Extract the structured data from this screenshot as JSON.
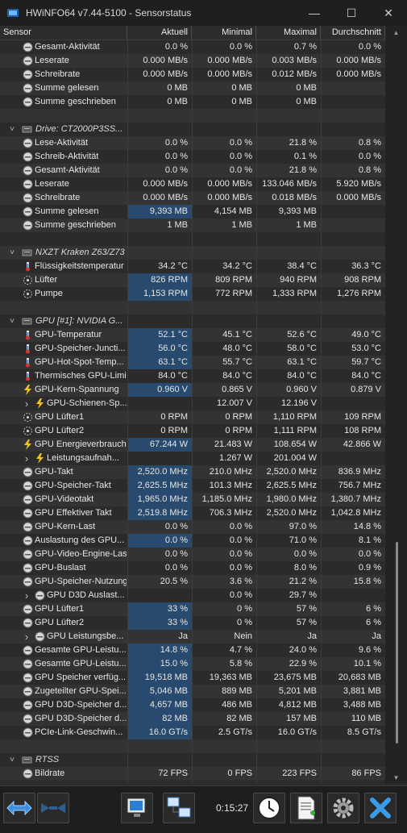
{
  "window": {
    "title": "HWiNFO64 v7.44-5100 - Sensorstatus"
  },
  "columns": [
    "Sensor",
    "Aktuell",
    "Minimal",
    "Maximal",
    "Durchschnitt"
  ],
  "rows": [
    {
      "type": "item",
      "icon": "circle",
      "label": "Gesamt-Aktivität",
      "v": [
        "0.0 %",
        "0.0 %",
        "0.7 %",
        "0.0 %"
      ]
    },
    {
      "type": "item",
      "icon": "circle",
      "label": "Leserate",
      "v": [
        "0.000 MB/s",
        "0.000 MB/s",
        "0.003 MB/s",
        "0.000 MB/s"
      ]
    },
    {
      "type": "item",
      "icon": "circle",
      "label": "Schreibrate",
      "v": [
        "0.000 MB/s",
        "0.000 MB/s",
        "0.012 MB/s",
        "0.000 MB/s"
      ]
    },
    {
      "type": "item",
      "icon": "circle",
      "label": "Summe gelesen",
      "v": [
        "0 MB",
        "0 MB",
        "0 MB",
        ""
      ]
    },
    {
      "type": "item",
      "icon": "circle",
      "label": "Summe geschrieben",
      "v": [
        "0 MB",
        "0 MB",
        "0 MB",
        ""
      ]
    },
    {
      "type": "blank"
    },
    {
      "type": "group",
      "label": "Drive: CT2000P3SS..."
    },
    {
      "type": "item",
      "icon": "circle",
      "label": "Lese-Aktivität",
      "v": [
        "0.0 %",
        "0.0 %",
        "21.8 %",
        "0.8 %"
      ]
    },
    {
      "type": "item",
      "icon": "circle",
      "label": "Schreib-Aktivität",
      "v": [
        "0.0 %",
        "0.0 %",
        "0.1 %",
        "0.0 %"
      ]
    },
    {
      "type": "item",
      "icon": "circle",
      "label": "Gesamt-Aktivität",
      "v": [
        "0.0 %",
        "0.0 %",
        "21.8 %",
        "0.8 %"
      ]
    },
    {
      "type": "item",
      "icon": "circle",
      "label": "Leserate",
      "v": [
        "0.000 MB/s",
        "0.000 MB/s",
        "133.046 MB/s",
        "5.920 MB/s"
      ]
    },
    {
      "type": "item",
      "icon": "circle",
      "label": "Schreibrate",
      "v": [
        "0.000 MB/s",
        "0.000 MB/s",
        "0.018 MB/s",
        "0.000 MB/s"
      ]
    },
    {
      "type": "item",
      "icon": "circle",
      "label": "Summe gelesen",
      "v": [
        "9,393 MB",
        "4,154 MB",
        "9,393 MB",
        ""
      ],
      "hl": true
    },
    {
      "type": "item",
      "icon": "circle",
      "label": "Summe geschrieben",
      "v": [
        "1 MB",
        "1 MB",
        "1 MB",
        ""
      ]
    },
    {
      "type": "blank"
    },
    {
      "type": "group",
      "label": "NXZT Kraken Z63/Z73"
    },
    {
      "type": "item",
      "icon": "thermo",
      "label": "Flüssigkeitstemperatur",
      "v": [
        "34.2 °C",
        "34.2 °C",
        "38.4 °C",
        "36.3 °C"
      ]
    },
    {
      "type": "item",
      "icon": "fan",
      "label": "Lüfter",
      "v": [
        "826 RPM",
        "809 RPM",
        "940 RPM",
        "908 RPM"
      ],
      "hl": true
    },
    {
      "type": "item",
      "icon": "fan",
      "label": "Pumpe",
      "v": [
        "1,153 RPM",
        "772 RPM",
        "1,333 RPM",
        "1,276 RPM"
      ],
      "hl": true
    },
    {
      "type": "blank"
    },
    {
      "type": "group",
      "label": "GPU [#1]: NVIDIA G..."
    },
    {
      "type": "item",
      "icon": "thermo",
      "label": "GPU-Temperatur",
      "v": [
        "52.1 °C",
        "45.1 °C",
        "52.6 °C",
        "49.0 °C"
      ],
      "hl": true
    },
    {
      "type": "item",
      "icon": "thermo",
      "label": "GPU-Speicher-Juncti...",
      "v": [
        "56.0 °C",
        "48.0 °C",
        "58.0 °C",
        "53.0 °C"
      ],
      "hl": true
    },
    {
      "type": "item",
      "icon": "thermo",
      "label": "GPU-Hot-Spot-Temp...",
      "v": [
        "63.1 °C",
        "55.7 °C",
        "63.1 °C",
        "59.7 °C"
      ],
      "hl": true
    },
    {
      "type": "item",
      "icon": "thermo",
      "label": "Thermisches GPU-Limit",
      "v": [
        "84.0 °C",
        "84.0 °C",
        "84.0 °C",
        "84.0 °C"
      ]
    },
    {
      "type": "item",
      "icon": "bolt",
      "label": "GPU-Kern-Spannung",
      "v": [
        "0.960 V",
        "0.865 V",
        "0.960 V",
        "0.879 V"
      ],
      "hl": true
    },
    {
      "type": "sub",
      "icon": "bolt",
      "label": "GPU-Schienen-Sp...",
      "v": [
        "",
        "12.007 V",
        "12.196 V",
        ""
      ]
    },
    {
      "type": "item",
      "icon": "fan",
      "label": "GPU Lüfter1",
      "v": [
        "0 RPM",
        "0 RPM",
        "1,110 RPM",
        "109 RPM"
      ]
    },
    {
      "type": "item",
      "icon": "fan",
      "label": "GPU Lüfter2",
      "v": [
        "0 RPM",
        "0 RPM",
        "1,111 RPM",
        "108 RPM"
      ]
    },
    {
      "type": "item",
      "icon": "bolt",
      "label": "GPU Energieverbrauch",
      "v": [
        "67.244 W",
        "21.483 W",
        "108.654 W",
        "42.866 W"
      ],
      "hl": true
    },
    {
      "type": "sub",
      "icon": "bolt",
      "label": "Leistungsaufnah...",
      "v": [
        "",
        "1.267 W",
        "201.004 W",
        ""
      ]
    },
    {
      "type": "item",
      "icon": "circle",
      "label": "GPU-Takt",
      "v": [
        "2,520.0 MHz",
        "210.0 MHz",
        "2,520.0 MHz",
        "836.9 MHz"
      ],
      "hl": true
    },
    {
      "type": "item",
      "icon": "circle",
      "label": "GPU-Speicher-Takt",
      "v": [
        "2,625.5 MHz",
        "101.3 MHz",
        "2,625.5 MHz",
        "756.7 MHz"
      ],
      "hl": true
    },
    {
      "type": "item",
      "icon": "circle",
      "label": "GPU-Videotakt",
      "v": [
        "1,965.0 MHz",
        "1,185.0 MHz",
        "1,980.0 MHz",
        "1,380.7 MHz"
      ],
      "hl": true
    },
    {
      "type": "item",
      "icon": "circle",
      "label": "GPU Effektiver Takt",
      "v": [
        "2,519.8 MHz",
        "706.3 MHz",
        "2,520.0 MHz",
        "1,042.8 MHz"
      ],
      "hl": true
    },
    {
      "type": "item",
      "icon": "circle",
      "label": "GPU-Kern-Last",
      "v": [
        "0.0 %",
        "0.0 %",
        "97.0 %",
        "14.8 %"
      ]
    },
    {
      "type": "item",
      "icon": "circle",
      "label": "Auslastung des GPU...",
      "v": [
        "0.0 %",
        "0.0 %",
        "71.0 %",
        "8.1 %"
      ],
      "hl": true
    },
    {
      "type": "item",
      "icon": "circle",
      "label": "GPU-Video-Engine-Last",
      "v": [
        "0.0 %",
        "0.0 %",
        "0.0 %",
        "0.0 %"
      ]
    },
    {
      "type": "item",
      "icon": "circle",
      "label": "GPU-Buslast",
      "v": [
        "0.0 %",
        "0.0 %",
        "8.0 %",
        "0.9 %"
      ]
    },
    {
      "type": "item",
      "icon": "circle",
      "label": "GPU-Speicher-Nutzung",
      "v": [
        "20.5 %",
        "3.6 %",
        "21.2 %",
        "15.8 %"
      ]
    },
    {
      "type": "sub",
      "icon": "circle",
      "label": "GPU D3D Auslast...",
      "v": [
        "",
        "0.0 %",
        "29.7 %",
        ""
      ]
    },
    {
      "type": "item",
      "icon": "circle",
      "label": "GPU Lüfter1",
      "v": [
        "33 %",
        "0 %",
        "57 %",
        "6 %"
      ],
      "hl": true
    },
    {
      "type": "item",
      "icon": "circle",
      "label": "GPU Lüfter2",
      "v": [
        "33 %",
        "0 %",
        "57 %",
        "6 %"
      ],
      "hl": true
    },
    {
      "type": "sub",
      "icon": "circle",
      "label": "GPU Leistungsbe...",
      "v": [
        "Ja",
        "Nein",
        "Ja",
        "Ja"
      ]
    },
    {
      "type": "item",
      "icon": "circle",
      "label": "Gesamte GPU-Leistu...",
      "v": [
        "14.8 %",
        "4.7 %",
        "24.0 %",
        "9.6 %"
      ],
      "hl": true
    },
    {
      "type": "item",
      "icon": "circle",
      "label": "Gesamte GPU-Leistu...",
      "v": [
        "15.0 %",
        "5.8 %",
        "22.9 %",
        "10.1 %"
      ],
      "hl": true
    },
    {
      "type": "item",
      "icon": "circle",
      "label": "GPU Speicher verfüg...",
      "v": [
        "19,518 MB",
        "19,363 MB",
        "23,675 MB",
        "20,683 MB"
      ],
      "hl": true
    },
    {
      "type": "item",
      "icon": "circle",
      "label": "Zugeteilter GPU-Spei...",
      "v": [
        "5,046 MB",
        "889 MB",
        "5,201 MB",
        "3,881 MB"
      ],
      "hl": true
    },
    {
      "type": "item",
      "icon": "circle",
      "label": "GPU D3D-Speicher d...",
      "v": [
        "4,657 MB",
        "486 MB",
        "4,812 MB",
        "3,488 MB"
      ],
      "hl": true
    },
    {
      "type": "item",
      "icon": "circle",
      "label": "GPU D3D-Speicher d...",
      "v": [
        "82 MB",
        "82 MB",
        "157 MB",
        "110 MB"
      ],
      "hl": true
    },
    {
      "type": "item",
      "icon": "circle",
      "label": "PCIe-Link-Geschwin...",
      "v": [
        "16.0 GT/s",
        "2.5 GT/s",
        "16.0 GT/s",
        "8.5 GT/s"
      ],
      "hl": true
    },
    {
      "type": "blank"
    },
    {
      "type": "group",
      "label": "RTSS"
    },
    {
      "type": "item",
      "icon": "circle",
      "label": "Bildrate",
      "v": [
        "72 FPS",
        "0 FPS",
        "223 FPS",
        "86 FPS"
      ]
    }
  ],
  "toolbar": {
    "timer": "0:15:27"
  },
  "colors": {
    "highlight": "#274a6e",
    "background": "#2b2b2b",
    "toolbar": "#1e1e1e"
  }
}
